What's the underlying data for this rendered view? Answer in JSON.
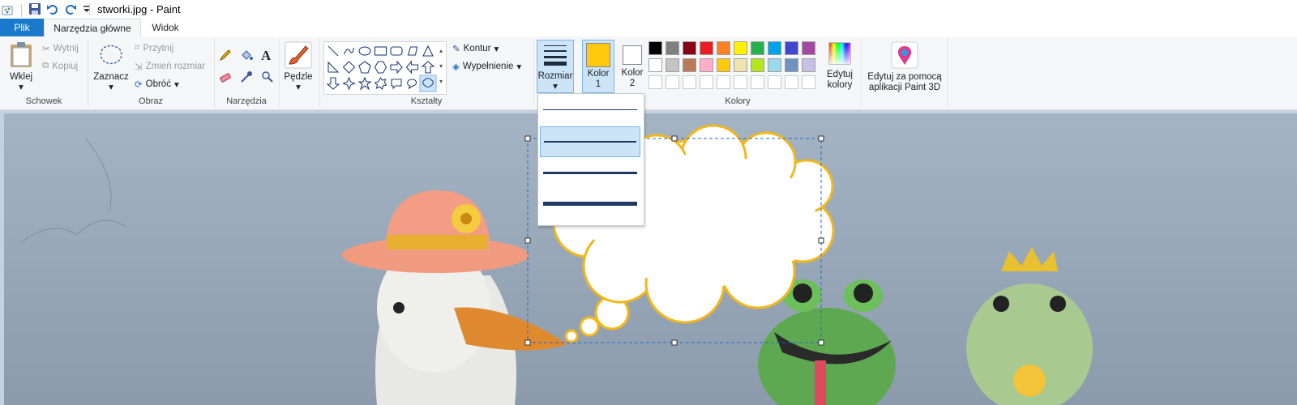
{
  "window": {
    "title": "stworki.jpg - Paint"
  },
  "tabs": {
    "file": "Plik",
    "home": "Narzędzia główne",
    "view": "Widok"
  },
  "groups": {
    "clipboard": {
      "label": "Schowek",
      "paste": "Wklej",
      "cut": "Wytnij",
      "copy": "Kopiuj"
    },
    "image": {
      "label": "Obraz",
      "select": "Zaznacz",
      "crop": "Przytnij",
      "resize": "Zmień rozmiar",
      "rotate": "Obróć"
    },
    "tools": {
      "label": "Narzędzia"
    },
    "brushes": {
      "label": "Pędzle"
    },
    "shapes": {
      "label": "Kształty",
      "outline": "Kontur",
      "fill": "Wypełnienie"
    },
    "size": {
      "label": "Rozmiar"
    },
    "colors": {
      "label": "Kolory",
      "color1_line1": "Kolor",
      "color1_line2": "1",
      "color2_line1": "Kolor",
      "color2_line2": "2",
      "edit_line1": "Edytuj",
      "edit_line2": "kolory",
      "color1_value": "#ffc90e",
      "color2_value": "#ffffff",
      "palette_row1": [
        "#000000",
        "#7f7f7f",
        "#880015",
        "#ed1c24",
        "#ff7f27",
        "#fff200",
        "#22b14c",
        "#00a2e8",
        "#3f48cc",
        "#a349a4"
      ],
      "palette_row2": [
        "#ffffff",
        "#c3c3c3",
        "#b97a57",
        "#ffaec9",
        "#ffc90e",
        "#efe4b0",
        "#b5e61d",
        "#99d9ea",
        "#7092be",
        "#c8bfe7"
      ],
      "palette_row3": [
        "#ffffff",
        "#ffffff",
        "#ffffff",
        "#ffffff",
        "#ffffff",
        "#ffffff",
        "#ffffff",
        "#ffffff",
        "#ffffff",
        "#ffffff"
      ]
    },
    "paint3d": {
      "line1": "Edytuj za pomocą",
      "line2": "aplikacji Paint 3D"
    }
  },
  "size_dropdown": {
    "selected_index": 1,
    "options_count": 4
  }
}
